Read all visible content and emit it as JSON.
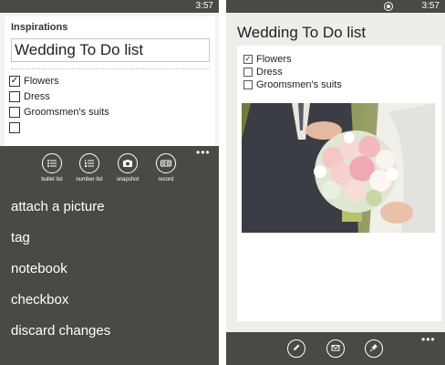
{
  "left": {
    "status_time": "3:57",
    "notebook_label": "Inspirations",
    "title_value": "Wedding To Do list",
    "checklist": [
      {
        "text": "Flowers",
        "checked": true
      },
      {
        "text": "Dress",
        "checked": false
      },
      {
        "text": "Groomsmen's suits",
        "checked": false
      },
      {
        "text": "",
        "checked": false
      }
    ],
    "appbar": {
      "buttons": [
        {
          "label": "bullet list",
          "icon": "bullet-list-icon"
        },
        {
          "label": "number list",
          "icon": "number-list-icon"
        },
        {
          "label": "snapshot",
          "icon": "camera-icon"
        },
        {
          "label": "record",
          "icon": "record-icon"
        }
      ],
      "more": "•••",
      "menu": [
        "attach a picture",
        "tag",
        "notebook",
        "checkbox",
        "discard changes"
      ]
    }
  },
  "right": {
    "status_time": "3:57",
    "title": "Wedding To Do list",
    "checklist": [
      {
        "text": "Flowers",
        "checked": true
      },
      {
        "text": "Dress",
        "checked": false
      },
      {
        "text": "Groomsmen's suits",
        "checked": false
      }
    ],
    "photo": "wedding-bouquet-photo",
    "appbar": {
      "buttons": [
        {
          "icon": "edit-icon"
        },
        {
          "icon": "email-icon"
        },
        {
          "icon": "pin-icon"
        }
      ],
      "more": "•••"
    }
  },
  "colors": {
    "appbar_bg": "#4a4a44",
    "page_bg": "#f5f3ef",
    "text": "#222222"
  }
}
